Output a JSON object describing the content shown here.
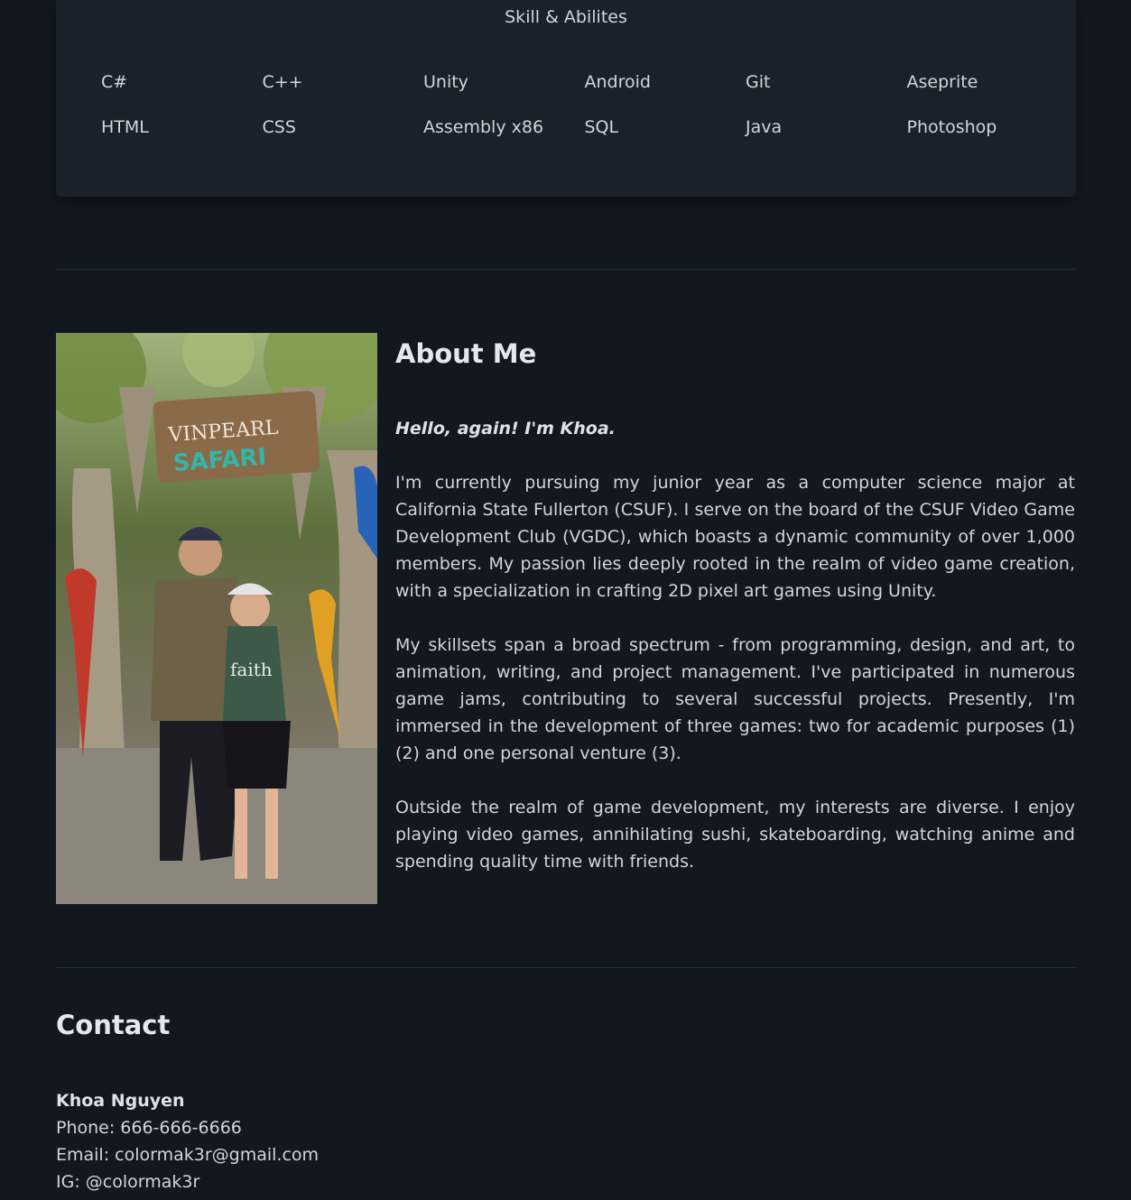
{
  "skills": {
    "title": "Skill & Abilites",
    "items": [
      "C#",
      "C++",
      "Unity",
      "Android",
      "Git",
      "Aseprite",
      "HTML",
      "CSS",
      "Assembly x86",
      "SQL",
      "Java",
      "Photoshop"
    ]
  },
  "photo": {
    "sign_line1": "VINPEARL",
    "sign_line2": "SAFARI",
    "shirt_text": "faith"
  },
  "about": {
    "heading": "About Me",
    "greeting": "Hello, again! I'm Khoa.",
    "paragraphs": [
      "I'm currently pursuing my junior year as a computer science major at California State Fullerton (CSUF). I serve on the board of the CSUF Video Game Development Club (VGDC), which boasts a dynamic community of over 1,000 members. My passion lies deeply rooted in the realm of video game creation, with a specialization in crafting 2D pixel art games using Unity.",
      "My skillsets span a broad spectrum - from programming, design, and art, to animation, writing, and project management. I've participated in numerous game jams, contributing to several successful projects. Presently, I'm immersed in the development of three games: two for academic purposes (1)(2) and one personal venture (3).",
      "Outside the realm of game development, my interests are diverse. I enjoy playing video games, annihilating sushi, skateboarding, watching anime and spending quality time with friends."
    ]
  },
  "contact": {
    "heading": "Contact",
    "name": "Khoa Nguyen",
    "phone": "Phone: 666-666-6666",
    "email": "Email: colormak3r@gmail.com",
    "ig": "IG: @colormak3r"
  },
  "colors": {
    "background": "#121820",
    "card": "#19212a",
    "text": "#cfd6dc"
  }
}
